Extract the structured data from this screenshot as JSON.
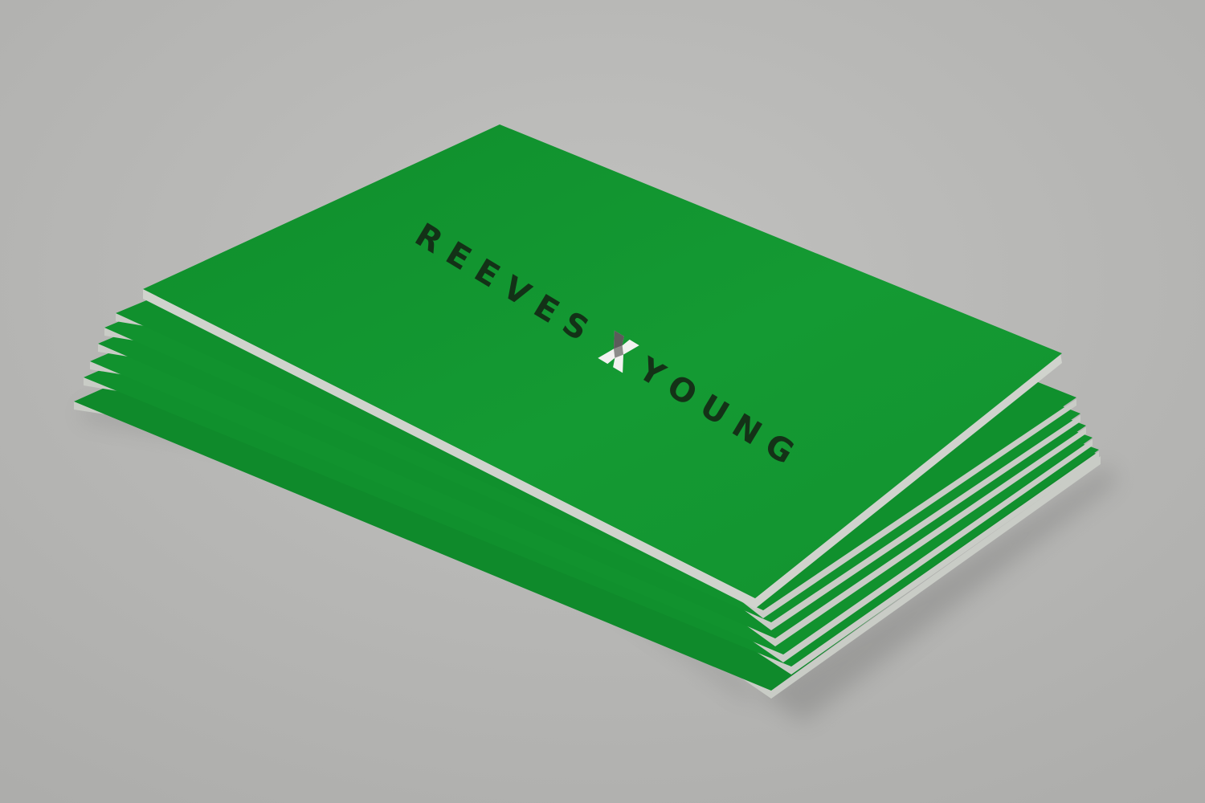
{
  "photo": {
    "subject": "business-card-stack",
    "colors": {
      "background": "#b9b9b7",
      "card_green": "#11952f",
      "card_green_dark": "#0d7d27",
      "card_edge": "#c9ccc6",
      "ink": "#142414",
      "logo_mark_light": "#f2f2f0",
      "logo_mark_mid": "#8c8c8a"
    }
  },
  "card": {
    "brand_left": "REEVES",
    "brand_right": "YOUNG",
    "logo_mark": "x-mark-icon"
  }
}
